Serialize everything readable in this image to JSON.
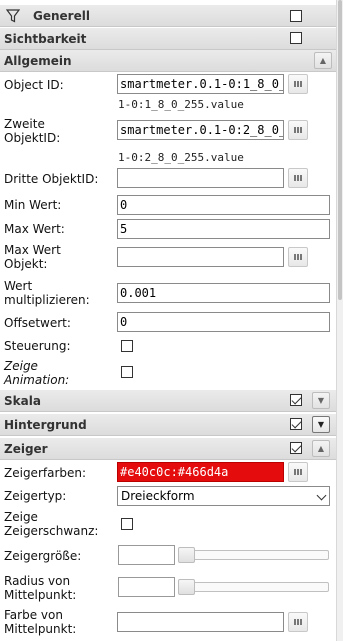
{
  "sections": {
    "generell": "Generell",
    "sichtbarkeit": "Sichtbarkeit",
    "allgemein": "Allgemein",
    "skala": "Skala",
    "hintergrund": "Hintergrund",
    "zeiger": "Zeiger"
  },
  "section_checks": {
    "generell": false,
    "sichtbarkeit": false,
    "skala": true,
    "hintergrund": true,
    "zeiger": true
  },
  "fields": {
    "object_id_label": "Object ID:",
    "object_id_value": "smartmeter.0.1-0:1_8_0_",
    "object_id_sub": "1-0:1_8_0_255.value",
    "zweite_label": "Zweite ObjektID:",
    "zweite_value": "smartmeter.0.1-0:2_8_0_",
    "zweite_sub": "1-0:2_8_0_255.value",
    "dritte_label": "Dritte ObjektID:",
    "dritte_value": "",
    "min_label": "Min Wert:",
    "min_value": "0",
    "max_label": "Max Wert:",
    "max_value": "5",
    "max_obj_label": "Max Wert Objekt:",
    "max_obj_value": "",
    "mult_label": "Wert multiplizieren:",
    "mult_value": "0.001",
    "offset_label": "Offsetwert:",
    "offset_value": "0",
    "steuerung_label": "Steuerung:",
    "steuerung_checked": false,
    "animation_label": "Zeige Animation:",
    "animation_checked": false,
    "zeigerfarben_label": "Zeigerfarben:",
    "zeigerfarben_value": "#e40c0c:#466d4a",
    "zeigertyp_label": "Zeigertyp:",
    "zeigertyp_value": "Dreieckform",
    "schwanz_label": "Zeige Zeigerschwanz:",
    "schwanz_checked": false,
    "groesse_label": "Zeigergröße:",
    "groesse_value": "",
    "radius_label": "Radius von Mittelpunkt:",
    "radius_value": "",
    "farbe_label": "Farbe von Mittelpunkt:",
    "farbe_value": ""
  },
  "colors": {
    "zeigerfarben_bg": "#e40c0c",
    "header_bg": "#e2e2e2"
  },
  "icons": {
    "generell": "filter-icon",
    "picker": "list-picker-icon",
    "collapse": "chevron-up-icon",
    "expand": "chevron-down-icon"
  }
}
